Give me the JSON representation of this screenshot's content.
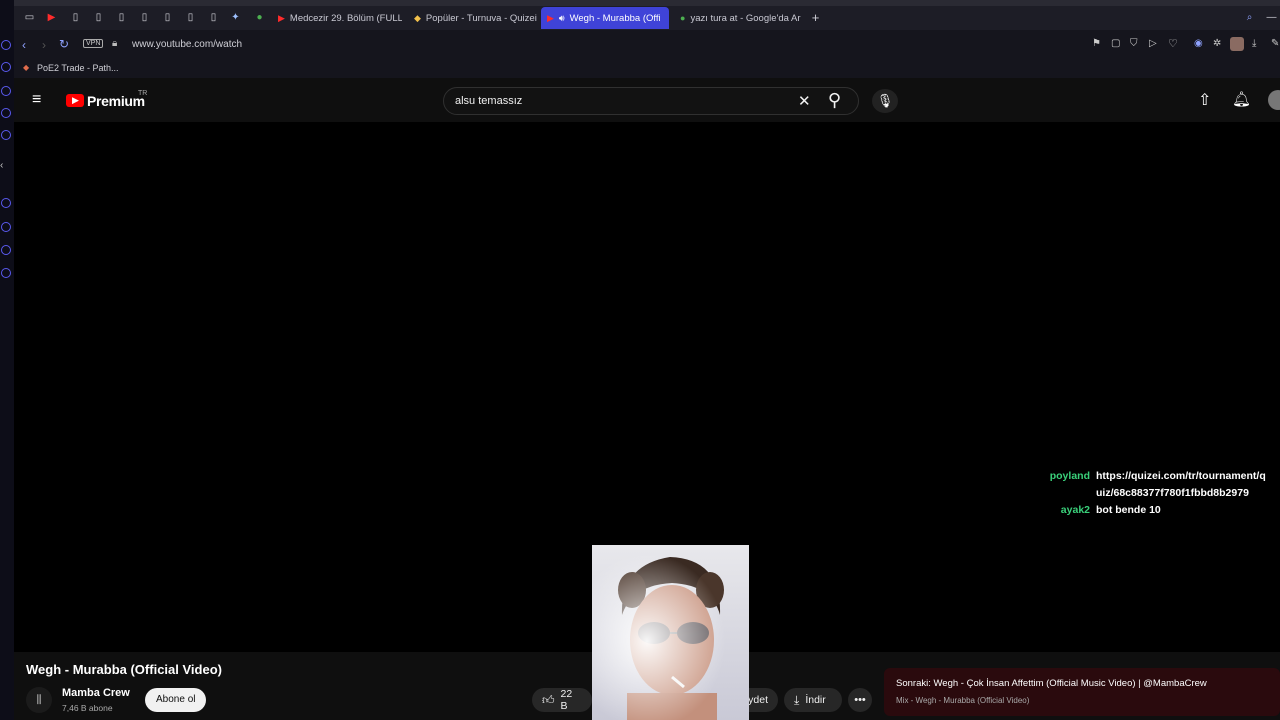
{
  "tabs": [
    {
      "label": "Medcezir 29. Bölüm (FULL",
      "active": false
    },
    {
      "label": "Popüler - Turnuva - Quizei",
      "active": false
    },
    {
      "label": "Wegh - Murabba (Offi",
      "active": true
    },
    {
      "label": "yazı tura at - Google'da Ar",
      "active": false
    }
  ],
  "address": {
    "vpn": "VPN",
    "url": "www.youtube.com/watch"
  },
  "bookmarks": [
    {
      "label": "PoE2 Trade - Path..."
    }
  ],
  "youtube": {
    "logo_text": "Premium",
    "region": "TR",
    "search_value": "alsu temassız"
  },
  "chat": [
    {
      "user": "poyland",
      "lines": [
        "https://quizei.com/tr/tournament/q",
        "uiz/68c88377f780f1fbbd8b2979"
      ]
    },
    {
      "user": "ayak2",
      "lines": [
        "bot bende 10"
      ]
    }
  ],
  "video": {
    "title": "Wegh - Murabba (Official Video)",
    "channel": "Mamba Crew",
    "subscribers": "7,46 B abone",
    "subscribe_label": "Abone ol",
    "likes": "22 B",
    "save_label": "ydet",
    "download_label": "İndir"
  },
  "up_next": {
    "title": "Sonraki: Wegh - Çok İnsan Affettim (Official Music Video) | @MambaCrew",
    "subtitle": "Mix - Wegh - Murabba (Official Video)"
  },
  "colors": {
    "accent_tab": "#3f43d8",
    "youtube_red": "#ff0000",
    "chat_name": "#3ad07a"
  }
}
